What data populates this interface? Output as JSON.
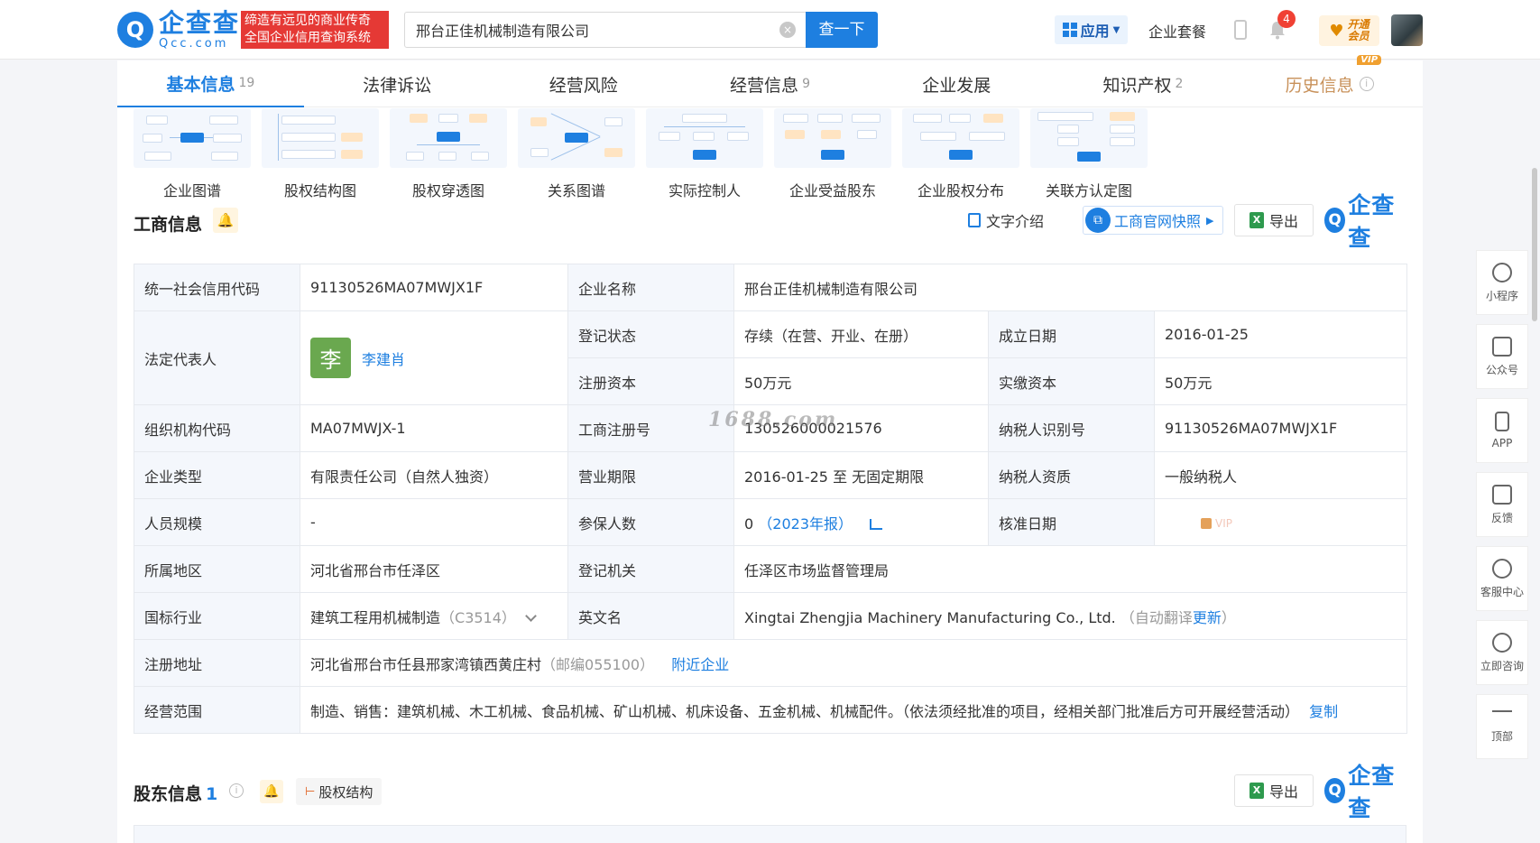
{
  "header": {
    "logo_cn": "企查查",
    "logo_en": "Qcc.com",
    "slogan_line1": "缔造有远见的商业传奇",
    "slogan_line2": "全国企业信用查询系统",
    "search_value": "邢台正佳机械制造有限公司",
    "search_button": "查一下",
    "app_label": "应用",
    "package_link": "企业套餐",
    "notification_count": "4",
    "vip_line1": "开通",
    "vip_line2": "会员"
  },
  "tabs": [
    {
      "label": "基本信息",
      "count": "19"
    },
    {
      "label": "法律诉讼",
      "count": ""
    },
    {
      "label": "经营风险",
      "count": ""
    },
    {
      "label": "经营信息",
      "count": "9"
    },
    {
      "label": "企业发展",
      "count": ""
    },
    {
      "label": "知识产权",
      "count": "2"
    },
    {
      "label": "历史信息",
      "count": "",
      "badge": "VIP"
    }
  ],
  "graphs": [
    {
      "label": "企业图谱"
    },
    {
      "label": "股权结构图"
    },
    {
      "label": "股权穿透图"
    },
    {
      "label": "关系图谱"
    },
    {
      "label": "实际控制人"
    },
    {
      "label": "企业受益股东"
    },
    {
      "label": "企业股权分布"
    },
    {
      "label": "关联方认定图"
    }
  ],
  "business_section": {
    "title": "工商信息",
    "text_intro": "文字介绍",
    "snapshot": "工商官网快照",
    "export": "导出",
    "brand": "企查查"
  },
  "info": {
    "credit_code_k": "统一社会信用代码",
    "credit_code_v": "91130526MA07MWJX1F",
    "company_name_k": "企业名称",
    "company_name_v": "邢台正佳机械制造有限公司",
    "legal_rep_k": "法定代表人",
    "legal_rep_avatar": "李",
    "legal_rep_v": "李建肖",
    "status_k": "登记状态",
    "status_v": "存续（在营、开业、在册）",
    "found_date_k": "成立日期",
    "found_date_v": "2016-01-25",
    "reg_capital_k": "注册资本",
    "reg_capital_v": "50万元",
    "paid_capital_k": "实缴资本",
    "paid_capital_v": "50万元",
    "org_code_k": "组织机构代码",
    "org_code_v": "MA07MWJX-1",
    "reg_no_k": "工商注册号",
    "reg_no_v": "130526000021576",
    "taxpayer_id_k": "纳税人识别号",
    "taxpayer_id_v": "91130526MA07MWJX1F",
    "type_k": "企业类型",
    "type_v": "有限责任公司（自然人独资）",
    "term_k": "营业期限",
    "term_v": "2016-01-25 至 无固定期限",
    "taxpayer_q_k": "纳税人资质",
    "taxpayer_q_v": "一般纳税人",
    "staff_k": "人员规模",
    "staff_v": "-",
    "insured_k": "参保人数",
    "insured_v": "0",
    "insured_year": "（2023年报）",
    "approval_k": "核准日期",
    "approval_v": "VIP",
    "region_k": "所属地区",
    "region_v": "河北省邢台市任泽区",
    "authority_k": "登记机关",
    "authority_v": "任泽区市场监督管理局",
    "industry_k": "国标行业",
    "industry_v": "建筑工程用机械制造",
    "industry_code": "（C3514）",
    "en_name_k": "英文名",
    "en_name_v": "Xingtai Zhengjia Machinery Manufacturing Co., Ltd.",
    "en_name_note": "（自动翻译",
    "en_name_update": "更新",
    "en_name_close": "）",
    "address_k": "注册地址",
    "address_v": "河北省邢台市任县邢家湾镇西黄庄村",
    "address_zip": "（邮编055100）",
    "nearby": "附近企业",
    "scope_k": "经营范围",
    "scope_v": "制造、销售：建筑机械、木工机械、食品机械、矿山机械、机床设备、五金机械、机械配件。（依法须经批准的项目，经相关部门批准后方可开展经营活动）",
    "copy": "复制"
  },
  "watermark": "1688.com",
  "shareholder_section": {
    "title": "股东信息",
    "count": "1",
    "struct_button": "股权结构",
    "export": "导出",
    "brand": "企查查"
  },
  "sidebar": [
    {
      "label": "小程序",
      "icon": "link-icon"
    },
    {
      "label": "公众号",
      "icon": "scan-icon"
    },
    {
      "label": "APP",
      "icon": "phone-icon"
    },
    {
      "label": "反馈",
      "icon": "edit-icon"
    },
    {
      "label": "客服中心",
      "icon": "headset-icon"
    },
    {
      "label": "立即咨询",
      "icon": "chat-icon"
    },
    {
      "label": "顶部",
      "icon": "arrow-up-icon"
    }
  ]
}
